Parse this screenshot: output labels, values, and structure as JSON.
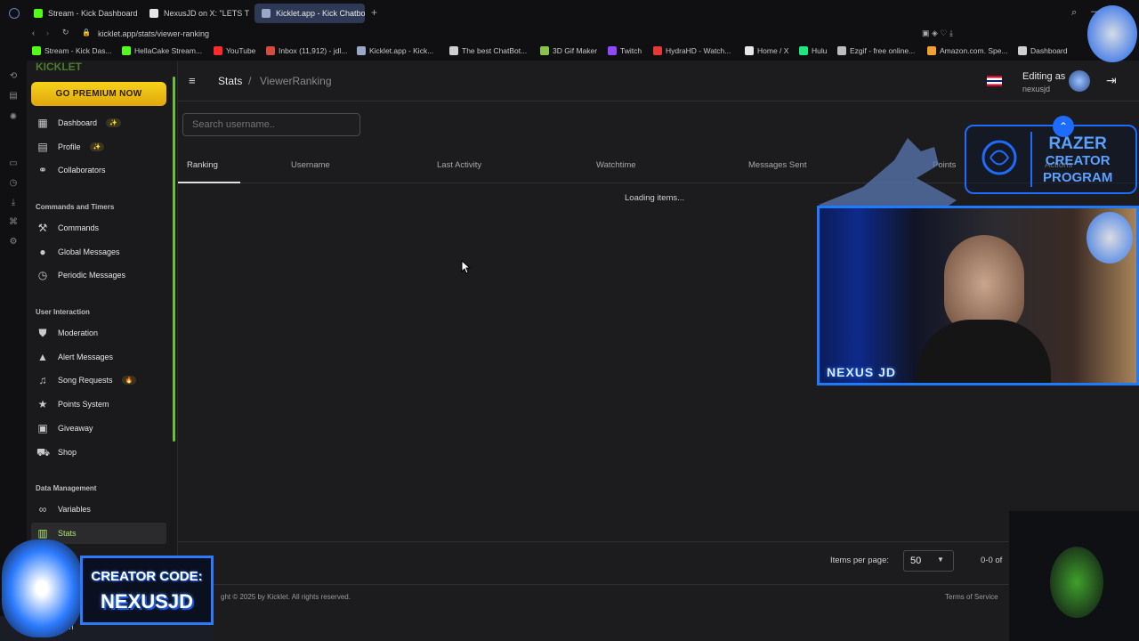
{
  "browser": {
    "tabs": [
      {
        "label": "Stream - Kick Dashboard",
        "fav_color": "#53fc18"
      },
      {
        "label": "NexusJD on X: \"LETS TC",
        "fav_color": "#e7e7e7"
      },
      {
        "label": "Kicklet.app - Kick Chatbo",
        "fav_color": "#9aa7c7",
        "active": true
      }
    ],
    "url": "kicklet.app/stats/viewer-ranking",
    "bookmarks": [
      {
        "label": "Stream - Kick Das...",
        "fav_color": "#53fc18"
      },
      {
        "label": "HellaCake Stream...",
        "fav_color": "#53fc18"
      },
      {
        "label": "YouTube",
        "fav_color": "#ff2b2b"
      },
      {
        "label": "Inbox (11,912) - jdl...",
        "fav_color": "#d64a3b"
      },
      {
        "label": "Kicklet.app - Kick...",
        "fav_color": "#9aa7c7"
      },
      {
        "label": "The best ChatBot...",
        "fav_color": "#cfcfcf"
      },
      {
        "label": "3D Gif Maker",
        "fav_color": "#8bc34a"
      },
      {
        "label": "Twitch",
        "fav_color": "#9147ff"
      },
      {
        "label": "HydraHD - Watch...",
        "fav_color": "#e53935"
      },
      {
        "label": "Home / X",
        "fav_color": "#e7e7e7"
      },
      {
        "label": "Hulu",
        "fav_color": "#1ce783"
      },
      {
        "label": "Ezgif - free online...",
        "fav_color": "#bdbdbd"
      },
      {
        "label": "Amazon.com. Spe...",
        "fav_color": "#f0a030"
      },
      {
        "label": "Dashboard",
        "fav_color": "#cfcfcf"
      }
    ]
  },
  "sidebar": {
    "premium_label": "GO PREMIUM NOW",
    "items_top": [
      {
        "label": "Dashboard",
        "icon": "dashboard-icon",
        "badge": "✨"
      },
      {
        "label": "Profile",
        "icon": "profile-icon",
        "badge": "✨"
      },
      {
        "label": "Collaborators",
        "icon": "collaborators-icon"
      }
    ],
    "section_commands": "Commands and Timers",
    "items_commands": [
      {
        "label": "Commands",
        "icon": "wrench-icon"
      },
      {
        "label": "Global Messages",
        "icon": "chat-icon"
      },
      {
        "label": "Periodic Messages",
        "icon": "clock-icon"
      }
    ],
    "section_interaction": "User Interaction",
    "items_interaction": [
      {
        "label": "Moderation",
        "icon": "shield-icon"
      },
      {
        "label": "Alert Messages",
        "icon": "warning-icon"
      },
      {
        "label": "Song Requests",
        "icon": "music-icon",
        "badge": "🔥"
      },
      {
        "label": "Points System",
        "icon": "star-icon"
      },
      {
        "label": "Giveaway",
        "icon": "gift-icon"
      },
      {
        "label": "Shop",
        "icon": "cart-icon"
      }
    ],
    "section_data": "Data Management",
    "items_data": [
      {
        "label": "Variables",
        "icon": "link-icon"
      },
      {
        "label": "Stats",
        "icon": "bar-chart-icon",
        "active": true
      }
    ]
  },
  "header": {
    "breadcrumb_root": "Stats",
    "breadcrumb_sep": "/",
    "breadcrumb_current": "ViewerRanking",
    "editing_as": "Editing as",
    "username": "nexusjd"
  },
  "main": {
    "search_placeholder": "Search username..",
    "columns": [
      "Ranking",
      "Username",
      "Last Activity",
      "Watchtime",
      "Messages Sent",
      "Points",
      "Actions"
    ],
    "loading_text": "Loading items...",
    "items_per_page_label": "Items per page:",
    "items_per_page_value": "50",
    "range_text": "0-0 of",
    "copyright": "ght © 2025 by Kicklet. All rights reserved.",
    "terms": "Terms of Service"
  },
  "overlay": {
    "razer_lines": [
      "RAZER",
      "CREATOR",
      "PROGRAM"
    ],
    "cam_name": "NEXUS JD",
    "creator_line1": "CREATOR CODE:",
    "creator_line2": "NEXUSJD",
    "taskbar_search": "earch"
  }
}
